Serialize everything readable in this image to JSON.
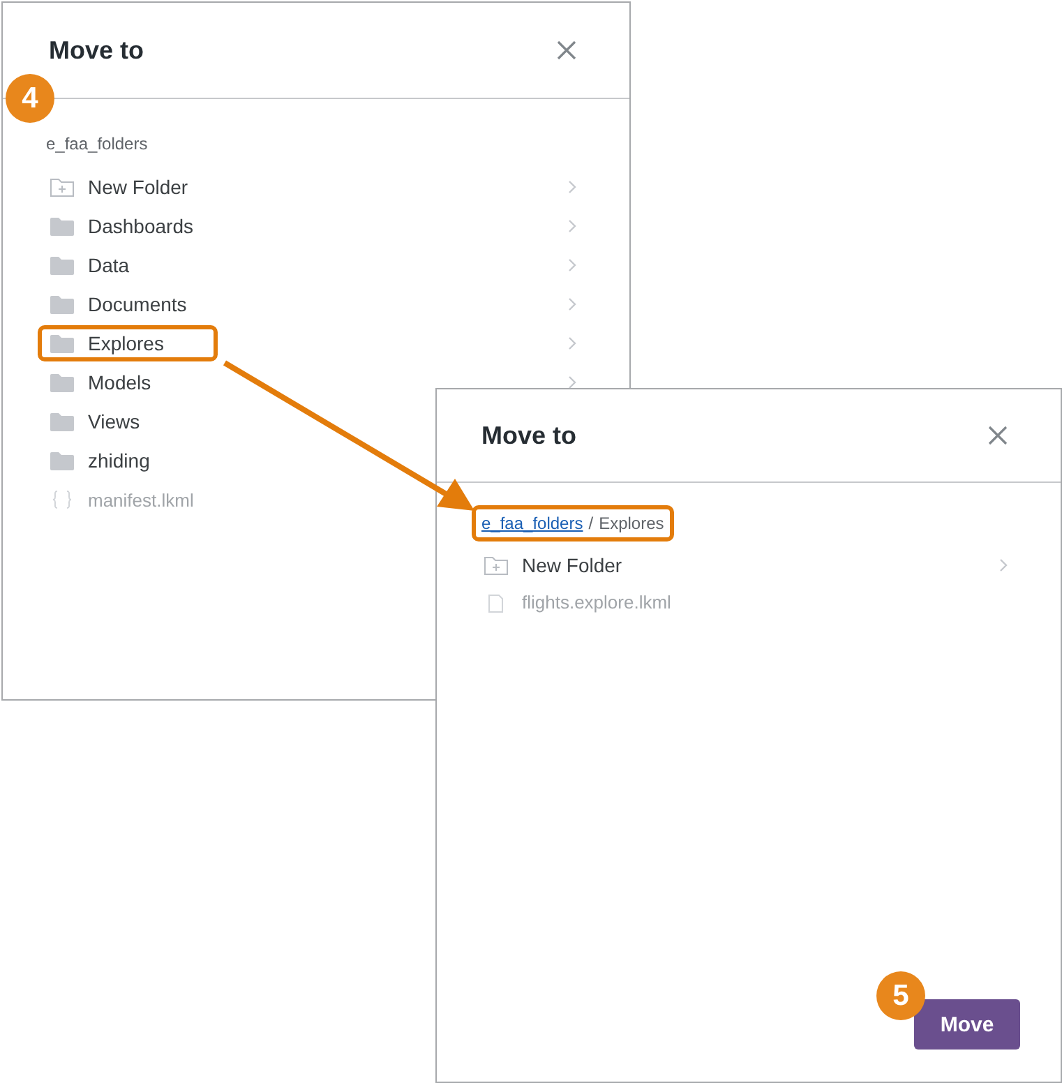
{
  "dialogs": [
    {
      "title": "Move to",
      "callout": "4",
      "breadcrumb": {
        "highlighted": false,
        "crumbs": [
          {
            "label": "e_faa_folders",
            "link": false
          }
        ]
      },
      "items": [
        {
          "label": "New Folder",
          "kind": "new_folder",
          "highlighted": false,
          "chevron": true
        },
        {
          "label": "Dashboards",
          "kind": "folder",
          "highlighted": false,
          "chevron": true
        },
        {
          "label": "Data",
          "kind": "folder",
          "highlighted": false,
          "chevron": true
        },
        {
          "label": "Documents",
          "kind": "folder",
          "highlighted": false,
          "chevron": true
        },
        {
          "label": "Explores",
          "kind": "folder",
          "highlighted": true,
          "chevron": true
        },
        {
          "label": "Models",
          "kind": "folder",
          "highlighted": false,
          "chevron": true
        },
        {
          "label": "Views",
          "kind": "folder",
          "highlighted": false,
          "chevron": false
        },
        {
          "label": "zhiding",
          "kind": "folder",
          "highlighted": false,
          "chevron": false
        },
        {
          "label": "manifest.lkml",
          "kind": "manifest",
          "highlighted": false,
          "chevron": false
        }
      ]
    },
    {
      "title": "Move to",
      "breadcrumb": {
        "highlighted": true,
        "separator": "/",
        "crumbs": [
          {
            "label": "e_faa_folders",
            "link": true
          },
          {
            "label": "Explores",
            "link": false
          }
        ]
      },
      "items": [
        {
          "label": "New Folder",
          "kind": "new_folder",
          "highlighted": false,
          "chevron": true
        },
        {
          "label": "flights.explore.lkml",
          "kind": "file",
          "highlighted": false,
          "chevron": false
        }
      ],
      "button": {
        "label": "Move",
        "callout": "5"
      }
    }
  ]
}
